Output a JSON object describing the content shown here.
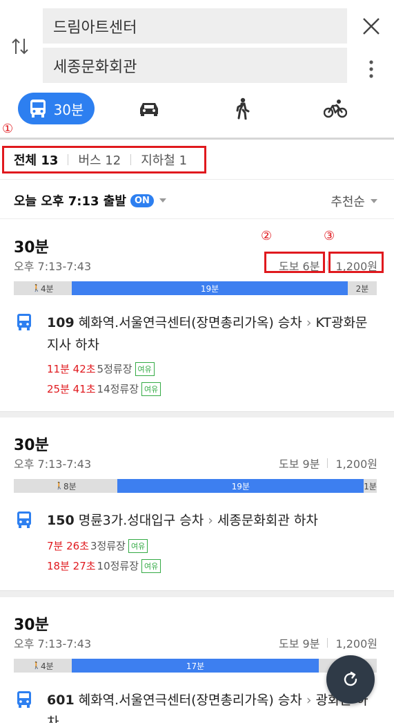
{
  "search": {
    "origin": "드림아트센터",
    "destination": "세종문화회관"
  },
  "mode_tabs": {
    "transit_label": "30분"
  },
  "annotations": [
    "①",
    "②",
    "③"
  ],
  "filter": {
    "items": [
      "전체 13",
      "버스 12",
      "지하철 1"
    ]
  },
  "sort_bar": {
    "depart": "오늘 오후 7:13 출발",
    "on": "ON",
    "sort": "추천순"
  },
  "routes": [
    {
      "duration": "30분",
      "time": "오후 7:13-7:43",
      "walk": "도보 6분",
      "fare": "1,200원",
      "segments": [
        {
          "type": "walk",
          "label": "4분",
          "minutes": 4
        },
        {
          "type": "bus",
          "label": "19분",
          "minutes": 19
        },
        {
          "type": "walk",
          "label": "2분",
          "minutes": 2
        }
      ],
      "bus_no": "109",
      "board": "혜화역.서울연극센터(장면총리가옥) 승차",
      "alight": "KT광화문지사 하차",
      "arrivals": [
        {
          "time": "11분 42초",
          "stops": "5정류장",
          "status": "여유"
        },
        {
          "time": "25분 41초",
          "stops": "14정류장",
          "status": "여유"
        }
      ]
    },
    {
      "duration": "30분",
      "time": "오후 7:13-7:43",
      "walk": "도보 9분",
      "fare": "1,200원",
      "segments": [
        {
          "type": "walk",
          "label": "8분",
          "minutes": 8
        },
        {
          "type": "bus",
          "label": "19분",
          "minutes": 19
        },
        {
          "type": "walk",
          "label": "1분",
          "minutes": 1
        }
      ],
      "bus_no": "150",
      "board": "명륜3가.성대입구 승차",
      "alight": "세종문화회관 하차",
      "arrivals": [
        {
          "time": "7분 26초",
          "stops": "3정류장",
          "status": "여유"
        },
        {
          "time": "18분 27초",
          "stops": "10정류장",
          "status": "여유"
        }
      ]
    },
    {
      "duration": "30분",
      "time": "오후 7:13-7:43",
      "walk": "도보 9분",
      "fare": "1,200원",
      "segments": [
        {
          "type": "walk",
          "label": "4분",
          "minutes": 4
        },
        {
          "type": "bus",
          "label": "17분",
          "minutes": 17
        },
        {
          "type": "walk",
          "label": "",
          "minutes": 4
        }
      ],
      "bus_no": "601",
      "board": "혜화역.서울연극센터(장면총리가옥) 승차",
      "alight": "광화문 하차",
      "arrivals": []
    }
  ],
  "colors": {
    "accent": "#2d7ff0",
    "highlight": "#e0191e",
    "arrival": "#e0191e",
    "badge": "#33aa44"
  }
}
